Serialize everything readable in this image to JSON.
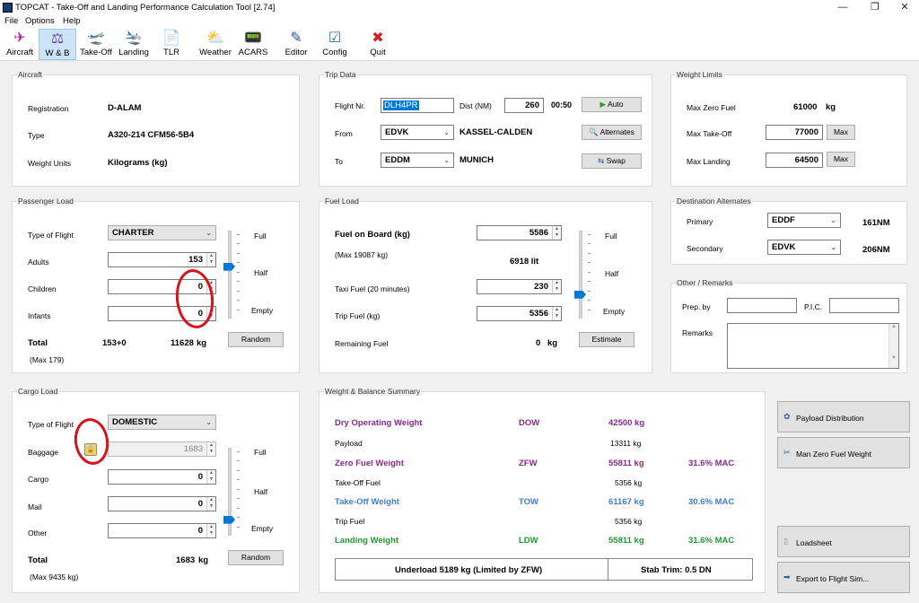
{
  "window": {
    "title": "TOPCAT - Take-Off and Landing Performance Calculation Tool [2.74]"
  },
  "menu": [
    "File",
    "Options",
    "Help"
  ],
  "toolbar": [
    {
      "label": "Aircraft",
      "icon": "airplane-icon",
      "glyph": "✈"
    },
    {
      "label": "W & B",
      "icon": "weight-balance-icon",
      "glyph": "⚖"
    },
    {
      "label": "Take-Off",
      "icon": "takeoff-icon",
      "glyph": "🛫"
    },
    {
      "label": "Landing",
      "icon": "landing-icon",
      "glyph": "🛬"
    },
    {
      "label": "TLR",
      "icon": "document-icon",
      "glyph": "📄"
    },
    {
      "label": "Weather",
      "icon": "weather-icon",
      "glyph": "⛅"
    },
    {
      "label": "ACARS",
      "icon": "acars-icon",
      "glyph": "📟"
    },
    {
      "label": "Editor",
      "icon": "editor-icon",
      "glyph": "✎"
    },
    {
      "label": "Config",
      "icon": "config-icon",
      "glyph": "☑"
    },
    {
      "label": "Quit",
      "icon": "quit-icon",
      "glyph": "✖"
    }
  ],
  "aircraft": {
    "title": "Aircraft",
    "registration_label": "Registration",
    "registration": "D-ALAM",
    "type_label": "Type",
    "type": "A320-214 CFM56-5B4",
    "units_label": "Weight Units",
    "units": "Kilograms (kg)"
  },
  "trip": {
    "title": "Trip Data",
    "flight_label": "Flight Nr.",
    "flight": "DLH4PR",
    "dist_label": "Dist (NM)",
    "dist": "260",
    "time": "00:50",
    "auto": "Auto",
    "from_label": "From",
    "from": "EDVK",
    "from_name": "KASSEL-CALDEN",
    "to_label": "To",
    "to": "EDDM",
    "to_name": "MUNICH",
    "alternates": "Alternates",
    "swap": "Swap"
  },
  "limits": {
    "title": "Weight Limits",
    "mzf_label": "Max Zero Fuel",
    "mzf": "61000",
    "unit": "kg",
    "mto_label": "Max Take-Off",
    "mto": "77000",
    "mlw_label": "Max Landing",
    "mlw": "64500",
    "max_btn": "Max"
  },
  "pax": {
    "title": "Passenger Load",
    "type_label": "Type of Flight",
    "type": "CHARTER",
    "adults_label": "Adults",
    "adults": "153",
    "children_label": "Children",
    "children": "0",
    "infants_label": "Infants",
    "infants": "0",
    "full": "Full",
    "half": "Half",
    "empty": "Empty",
    "total_label": "Total",
    "total_count": "153+0",
    "total_weight": "11628",
    "unit": "kg",
    "max": "(Max 179)",
    "random": "Random",
    "slider_level": 0.6
  },
  "fuel": {
    "title": "Fuel Load",
    "fob_label": "Fuel on Board (kg)",
    "fob": "5586",
    "max": "(Max 19087 kg)",
    "lit": "6918 lit",
    "taxi_label": "Taxi Fuel (20 minutes)",
    "taxi": "230",
    "trip_label": "Trip Fuel (kg)",
    "trip": "5356",
    "rem_label": "Remaining Fuel",
    "rem": "0",
    "unit": "kg",
    "full": "Full",
    "half": "Half",
    "empty": "Empty",
    "estimate": "Estimate",
    "slider_level": 0.25
  },
  "dest": {
    "title": "Destination Alternates",
    "primary_label": "Primary",
    "primary": "EDDF",
    "primary_dist": "161NM",
    "secondary_label": "Secondary",
    "secondary": "EDVK",
    "secondary_dist": "206NM"
  },
  "other": {
    "title": "Other / Remarks",
    "prep_label": "Prep. by",
    "pic_label": "P.I.C.",
    "remarks_label": "Remarks"
  },
  "cargo": {
    "title": "Cargo Load",
    "type_label": "Type of Flight",
    "type": "DOMESTIC",
    "baggage_label": "Baggage",
    "baggage": "1683",
    "cargo_label": "Cargo",
    "cargo": "0",
    "mail_label": "Mail",
    "mail": "0",
    "other_label": "Other",
    "other": "0",
    "full": "Full",
    "half": "Half",
    "empty": "Empty",
    "total_label": "Total",
    "total": "1683",
    "unit": "kg",
    "max": "(Max 9435 kg)",
    "random": "Random",
    "slider_level": 0.15
  },
  "summary": {
    "title": "Weight & Balance Summary",
    "dow_label": "Dry Operating Weight",
    "dow_code": "DOW",
    "dow": "42500 kg",
    "payload_label": "Payload",
    "payload": "13311 kg",
    "zfw_label": "Zero Fuel Weight",
    "zfw_code": "ZFW",
    "zfw": "55811 kg",
    "zfw_mac": "31.6% MAC",
    "tof_label": "Take-Off Fuel",
    "tof": "5356 kg",
    "tow_label": "Take-Off Weight",
    "tow_code": "TOW",
    "tow": "61167 kg",
    "tow_mac": "30.6% MAC",
    "trip_label": "Trip Fuel",
    "trip": "5356 kg",
    "ldw_label": "Landing Weight",
    "ldw_code": "LDW",
    "ldw": "55811 kg",
    "ldw_mac": "31.6% MAC",
    "underload": "Underload 5189 kg (Limited by ZFW)",
    "trim": "Stab Trim:  0.5 DN"
  },
  "actions": {
    "payload": "Payload Distribution",
    "manzfw": "Man Zero Fuel Weight",
    "loadsheet": "Loadsheet",
    "export": "Export to Flight Sim..."
  },
  "colors": {
    "dow": "#8a2a8f",
    "zfw": "#8a2a8f",
    "tow": "#3f7fcf",
    "ldw": "#1f9a2f",
    "annotation": "#d6131b"
  }
}
